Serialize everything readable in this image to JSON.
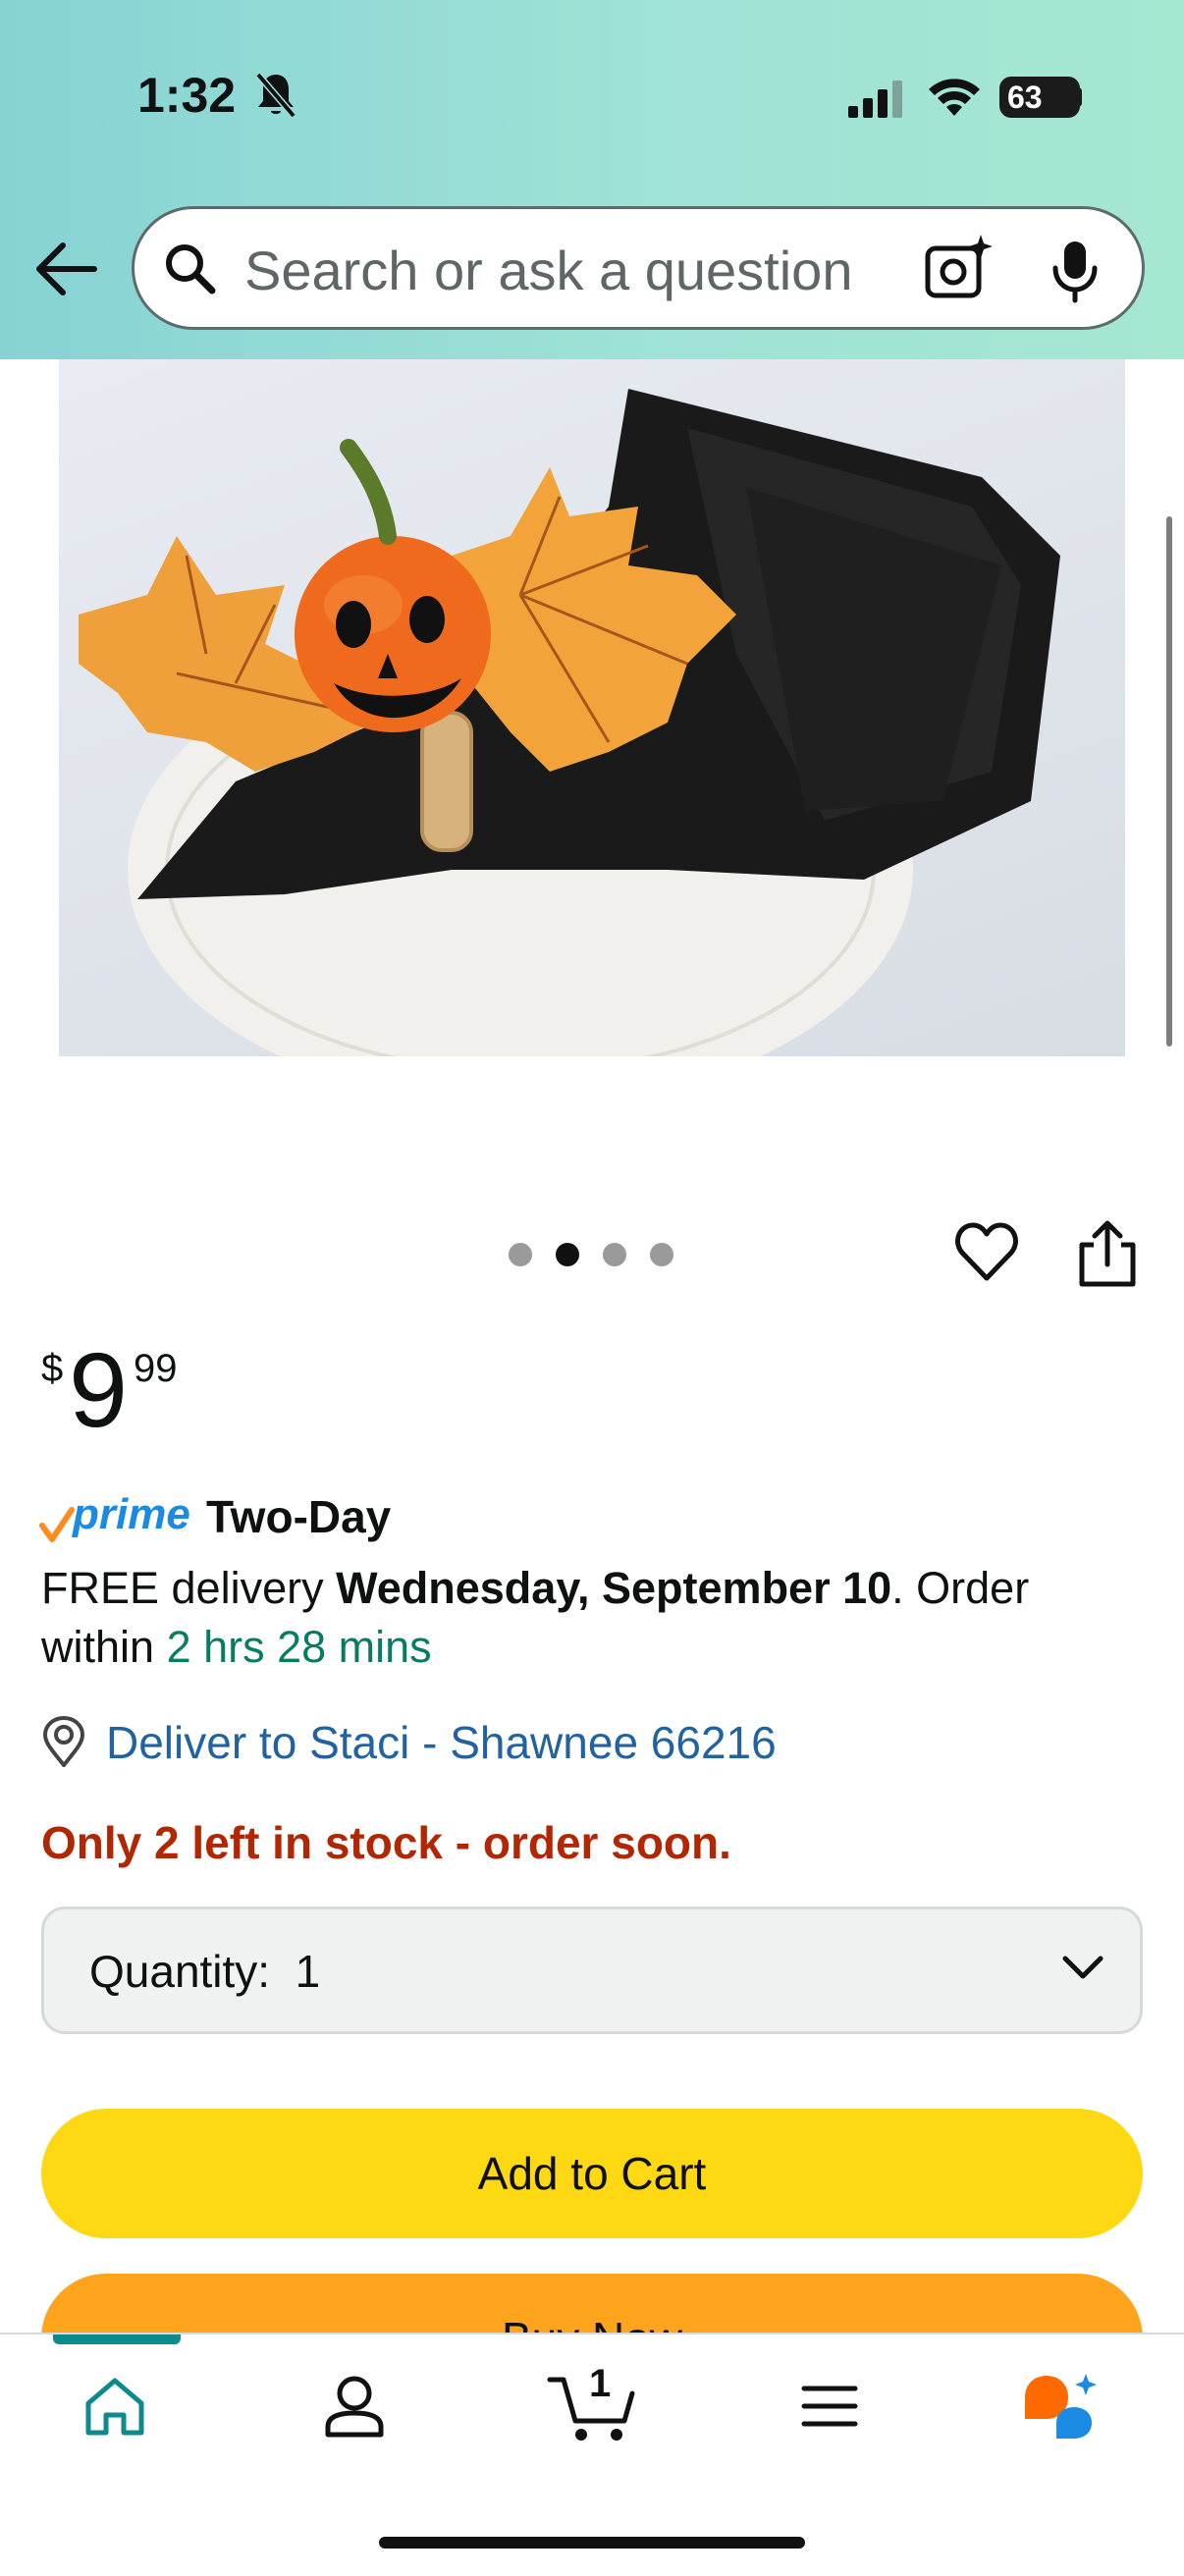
{
  "status_bar": {
    "time": "1:32",
    "battery": "63"
  },
  "search": {
    "placeholder": "Search or ask a question"
  },
  "product": {
    "image_description_icon": "halloween-napkin-ring-photo",
    "image_dots_count": 4,
    "active_dot_index": 1
  },
  "price": {
    "symbol": "$",
    "whole": "9",
    "fraction": "99"
  },
  "delivery": {
    "prime_label": "prime",
    "prime_speed": "Two-Day",
    "free_delivery_prefix": "FREE delivery ",
    "delivery_date": "Wednesday, September 10",
    "order_within_prefix": ". Order within ",
    "countdown": "2 hrs 28 mins",
    "deliver_to": "Deliver to Staci - Shawnee 66216"
  },
  "stock": {
    "message": "Only 2 left in stock - order soon."
  },
  "quantity": {
    "label": "Quantity:  1"
  },
  "actions": {
    "add_to_cart": "Add to Cart",
    "buy_now": "Buy Now"
  },
  "bottom_nav": {
    "cart_count": "1",
    "items": [
      "home-icon",
      "account-icon",
      "cart-icon",
      "menu-icon",
      "rufus-icon"
    ]
  },
  "colors": {
    "accent_teal": "#0e8a8f",
    "link_blue": "#2162a1",
    "stock_red": "#b12704",
    "countdown_green": "#067d62",
    "add_to_cart_yellow": "#ffd814",
    "buy_now_orange": "#ffa41c",
    "prime_blue": "#1a8ae2"
  }
}
